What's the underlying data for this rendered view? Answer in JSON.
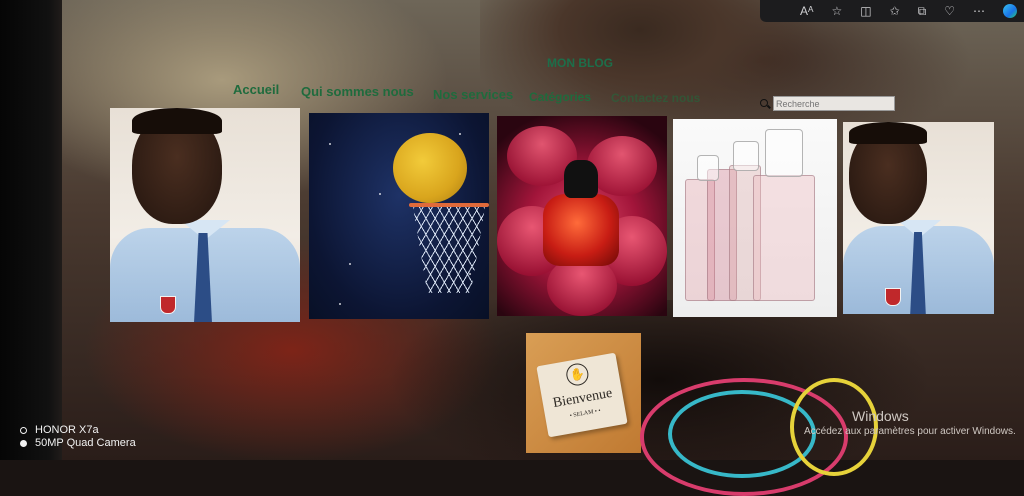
{
  "header": {
    "brand": "MON BLOG"
  },
  "nav": {
    "items": [
      {
        "label": "Accueil"
      },
      {
        "label": "Qui sommes nous"
      },
      {
        "label": "Nos services"
      },
      {
        "label": "Catégories"
      },
      {
        "label": "Contactez nous"
      }
    ]
  },
  "search": {
    "placeholder": "Recherche",
    "icon": "search-icon"
  },
  "gallery": {
    "items": [
      {
        "subject": "portrait"
      },
      {
        "subject": "moon-basketball-hoop"
      },
      {
        "subject": "red-perfume-flower"
      },
      {
        "subject": "perfume-bottles"
      },
      {
        "subject": "portrait"
      },
      {
        "subject": "welcome-card"
      }
    ],
    "welcome_card": {
      "text": "Bienvenue",
      "subtext": "• SELAM • •"
    }
  },
  "windows_activation": {
    "title": "Windows",
    "message": "Accédez aux paramètres pour activer Windows."
  },
  "camera_watermark": {
    "model": "HONOR X7a",
    "camera": "50MP Quad Camera"
  },
  "colors": {
    "nav_text": "#1f6b3d",
    "brand_text": "#1d6e4a"
  }
}
